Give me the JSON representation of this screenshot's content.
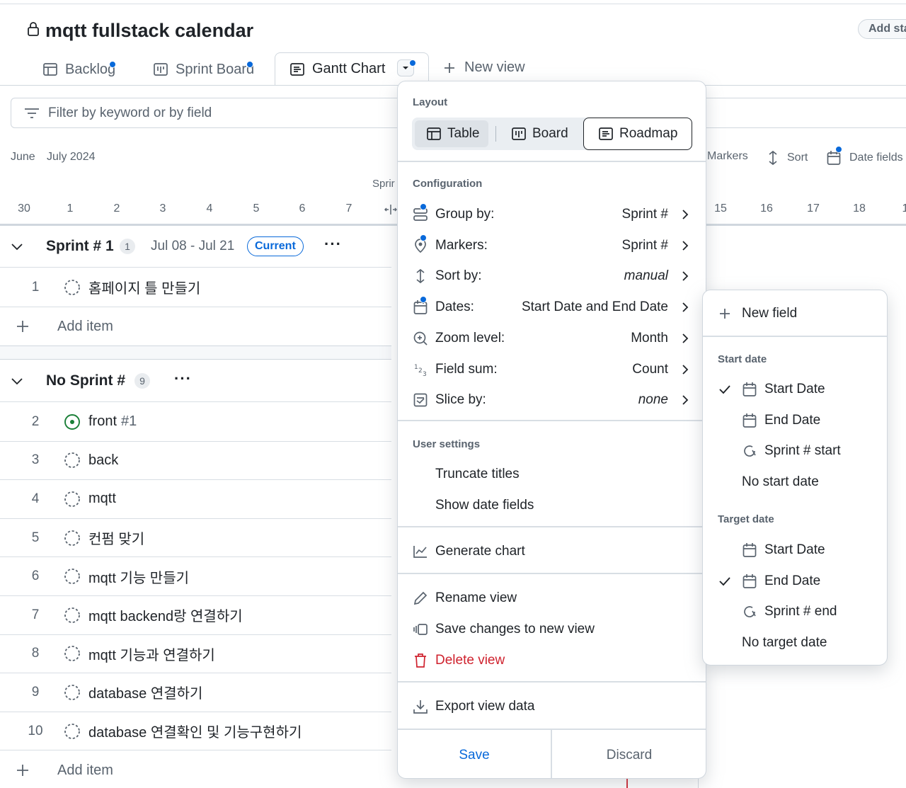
{
  "project": {
    "title": "mqtt fullstack calendar",
    "add_status_label": "Add sta"
  },
  "tabs": [
    {
      "label": "Backlog",
      "icon": "table-icon",
      "dirty": true
    },
    {
      "label": "Sprint Board",
      "icon": "board-icon",
      "dirty": true
    },
    {
      "label": "Gantt Chart",
      "icon": "roadmap-icon",
      "dirty": true,
      "active": true
    }
  ],
  "new_view_label": "New view",
  "filter": {
    "placeholder": "Filter by keyword or by field"
  },
  "timeline": {
    "months": [
      "June",
      "July 2024"
    ],
    "sprint_label": "Sprir",
    "days_left": [
      "30",
      "1",
      "2",
      "3",
      "4",
      "5",
      "6",
      "7"
    ],
    "days_right": [
      "15",
      "16",
      "17",
      "18",
      "1"
    ],
    "toolbar": {
      "markers": "Markers",
      "sort": "Sort",
      "date_fields": "Date fields"
    }
  },
  "groups": [
    {
      "name": "Sprint # 1",
      "count": "1",
      "dates": "Jul 08 - Jul 21",
      "badge": "Current",
      "items": [
        {
          "num": "1",
          "title": "홈페이지 틀 만들기",
          "status": "todo"
        }
      ],
      "add_item_label": "Add item"
    },
    {
      "name": "No Sprint #",
      "count": "9",
      "items": [
        {
          "num": "2",
          "title": "front",
          "ref": "#1",
          "status": "in-progress"
        },
        {
          "num": "3",
          "title": "back",
          "status": "todo"
        },
        {
          "num": "4",
          "title": "mqtt",
          "status": "todo"
        },
        {
          "num": "5",
          "title": "컨펌 맞기",
          "status": "todo"
        },
        {
          "num": "6",
          "title": "mqtt 기능 만들기",
          "status": "todo"
        },
        {
          "num": "7",
          "title": "mqtt backend랑 연결하기",
          "status": "todo"
        },
        {
          "num": "8",
          "title": "mqtt 기능과 연결하기",
          "status": "todo"
        },
        {
          "num": "9",
          "title": "database 연결하기",
          "status": "todo"
        },
        {
          "num": "10",
          "title": "database 연결확인 및 기능구현하기",
          "status": "todo"
        }
      ],
      "add_item_label": "Add item"
    }
  ],
  "view_menu": {
    "layout_title": "Layout",
    "layout_options": [
      "Table",
      "Board",
      "Roadmap"
    ],
    "layout_selected": "Roadmap",
    "configuration_title": "Configuration",
    "configuration": [
      {
        "label": "Group by:",
        "value": "Sprint #",
        "icon": "group-icon",
        "dirty": true
      },
      {
        "label": "Markers:",
        "value": "Sprint #",
        "icon": "marker-icon",
        "dirty": true
      },
      {
        "label": "Sort by:",
        "value": "manual",
        "italic": true,
        "icon": "sort-icon"
      },
      {
        "label": "Dates:",
        "value": "Start Date and End Date",
        "icon": "calendar-icon",
        "dirty": true
      },
      {
        "label": "Zoom level:",
        "value": "Month",
        "icon": "zoom-icon"
      },
      {
        "label": "Field sum:",
        "value": "Count",
        "icon": "field-sum-icon"
      },
      {
        "label": "Slice by:",
        "value": "none",
        "italic": true,
        "icon": "slice-icon"
      }
    ],
    "user_settings_title": "User settings",
    "user_settings": [
      "Truncate titles",
      "Show date fields"
    ],
    "generate_chart": "Generate chart",
    "rename_view": "Rename view",
    "save_changes_new": "Save changes to new view",
    "delete_view": "Delete view",
    "export_view": "Export view data",
    "save": "Save",
    "discard": "Discard"
  },
  "dates_submenu": {
    "new_field": "New field",
    "start_title": "Start date",
    "start_options": [
      {
        "label": "Start Date",
        "icon": "calendar-icon",
        "checked": true
      },
      {
        "label": "End Date",
        "icon": "calendar-icon",
        "checked": false
      },
      {
        "label": "Sprint # start",
        "icon": "iteration-icon",
        "checked": false
      },
      {
        "label": "No start date",
        "checked": false
      }
    ],
    "target_title": "Target date",
    "target_options": [
      {
        "label": "Start Date",
        "icon": "calendar-icon",
        "checked": false
      },
      {
        "label": "End Date",
        "icon": "calendar-icon",
        "checked": true
      },
      {
        "label": "Sprint # end",
        "icon": "iteration-icon",
        "checked": false
      },
      {
        "label": "No target date",
        "checked": false
      }
    ]
  },
  "colors": {
    "accent": "#0969da",
    "danger": "#cf222e",
    "done_green": "#1a7f37",
    "muted": "#59636e"
  }
}
